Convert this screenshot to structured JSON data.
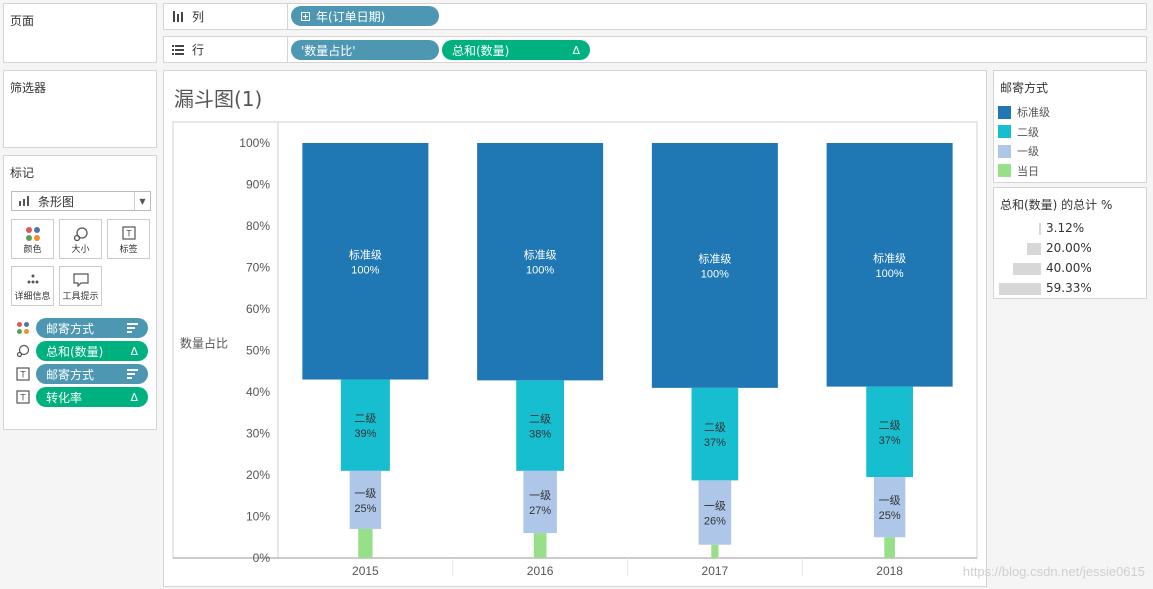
{
  "cards": {
    "pages": "页面",
    "filters": "筛选器",
    "marks": "标记"
  },
  "columns_shelf": {
    "label": "列",
    "pills": [
      {
        "label": "年(订单日期)",
        "kind": "dimension"
      }
    ]
  },
  "rows_shelf": {
    "label": "行",
    "pills": [
      {
        "label": "'数量占比'",
        "kind": "dimension"
      },
      {
        "label": "总和(数量)",
        "kind": "measure"
      }
    ]
  },
  "marks_card": {
    "mark_type": "条形图",
    "buttons": [
      "颜色",
      "大小",
      "标签",
      "详细信息",
      "工具提示"
    ],
    "fields": [
      {
        "icon": "color-icon",
        "label": "邮寄方式",
        "kind": "dimension"
      },
      {
        "icon": "size-icon",
        "label": "总和(数量)",
        "kind": "measure"
      },
      {
        "icon": "label-icon",
        "label": "邮寄方式",
        "kind": "dimension"
      },
      {
        "icon": "label-icon",
        "label": "转化率",
        "kind": "measure"
      }
    ]
  },
  "sheet_title": "漏斗图(1)",
  "chart_data": {
    "type": "bar",
    "ylabel": "数量占比",
    "xlabel": "",
    "ylim": [
      0,
      100
    ],
    "y_ticks": [
      "100%",
      "90%",
      "80%",
      "70%",
      "60%",
      "50%",
      "40%",
      "30%",
      "20%",
      "10%",
      "0%"
    ],
    "categories": [
      "2015",
      "2016",
      "2017",
      "2018"
    ],
    "series": [
      {
        "name": "标准级",
        "color": "#1f77b4",
        "text_color": "#ffffff",
        "percent_labels": [
          "100%",
          "100%",
          "100%",
          "100%"
        ],
        "upper": [
          100,
          100,
          100,
          100
        ],
        "lower": [
          43,
          42.8,
          41,
          41.3
        ],
        "width_pct": [
          59.33,
          59.33,
          59.33,
          59.33
        ]
      },
      {
        "name": "二级",
        "color": "#17becf",
        "text_color": "#333333",
        "percent_labels": [
          "39%",
          "38%",
          "37%",
          "37%"
        ],
        "upper": [
          43,
          42.8,
          41,
          41.3
        ],
        "lower": [
          21,
          21,
          18.7,
          19.5
        ],
        "width_pct": [
          23.1,
          22.5,
          22.0,
          22.0
        ]
      },
      {
        "name": "一级",
        "color": "#aec7e8",
        "text_color": "#333333",
        "percent_labels": [
          "25%",
          "27%",
          "26%",
          "25%"
        ],
        "upper": [
          21,
          21,
          18.7,
          19.5
        ],
        "lower": [
          7,
          6,
          3.2,
          5
        ],
        "width_pct": [
          14.8,
          15.8,
          15.4,
          14.8
        ]
      },
      {
        "name": "当日",
        "color": "#98df8a",
        "text_color": "#333333",
        "percent_labels": [
          "",
          "",
          "",
          ""
        ],
        "upper": [
          7,
          6,
          3.2,
          5
        ],
        "lower": [
          0,
          0,
          0,
          0
        ],
        "width_pct": [
          6.8,
          6.0,
          3.4,
          5.0
        ]
      }
    ]
  },
  "legend_color": {
    "title": "邮寄方式",
    "items": [
      {
        "label": "标准级",
        "color": "#1f77b4"
      },
      {
        "label": "二级",
        "color": "#17becf"
      },
      {
        "label": "一级",
        "color": "#aec7e8"
      },
      {
        "label": "当日",
        "color": "#98df8a"
      }
    ]
  },
  "legend_size": {
    "title": "总和(数量) 的总计 %",
    "items": [
      {
        "label": "3.12%",
        "value": 3.12
      },
      {
        "label": "20.00%",
        "value": 20.0
      },
      {
        "label": "40.00%",
        "value": 40.0
      },
      {
        "label": "59.33%",
        "value": 59.33
      }
    ]
  },
  "watermark": "https://blog.csdn.net/jessie0615"
}
